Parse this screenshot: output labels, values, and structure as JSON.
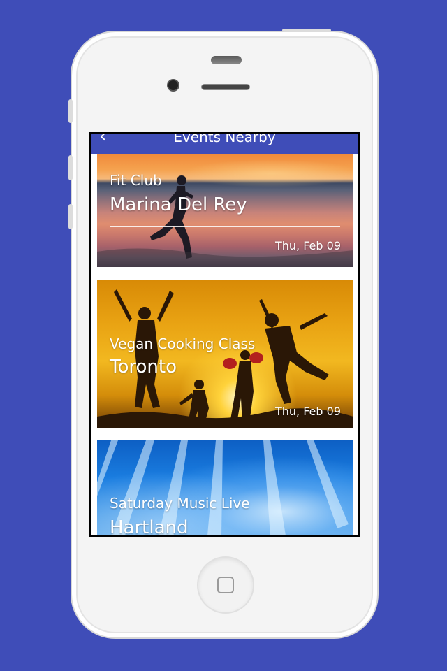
{
  "navbar": {
    "title": "Events Nearby",
    "back_icon": "chevron-left-icon"
  },
  "events": [
    {
      "name": "Fit Club",
      "location": "Marina Del Rey",
      "date": "Thu, Feb 09"
    },
    {
      "name": "Vegan Cooking Class",
      "location": "Toronto",
      "date": "Thu, Feb 09"
    },
    {
      "name": "Saturday Music Live",
      "location": "Hartland",
      "date": ""
    }
  ],
  "colors": {
    "background": "#3f4db8",
    "navbar": "#3f4db8",
    "card_text": "#ffffff"
  }
}
